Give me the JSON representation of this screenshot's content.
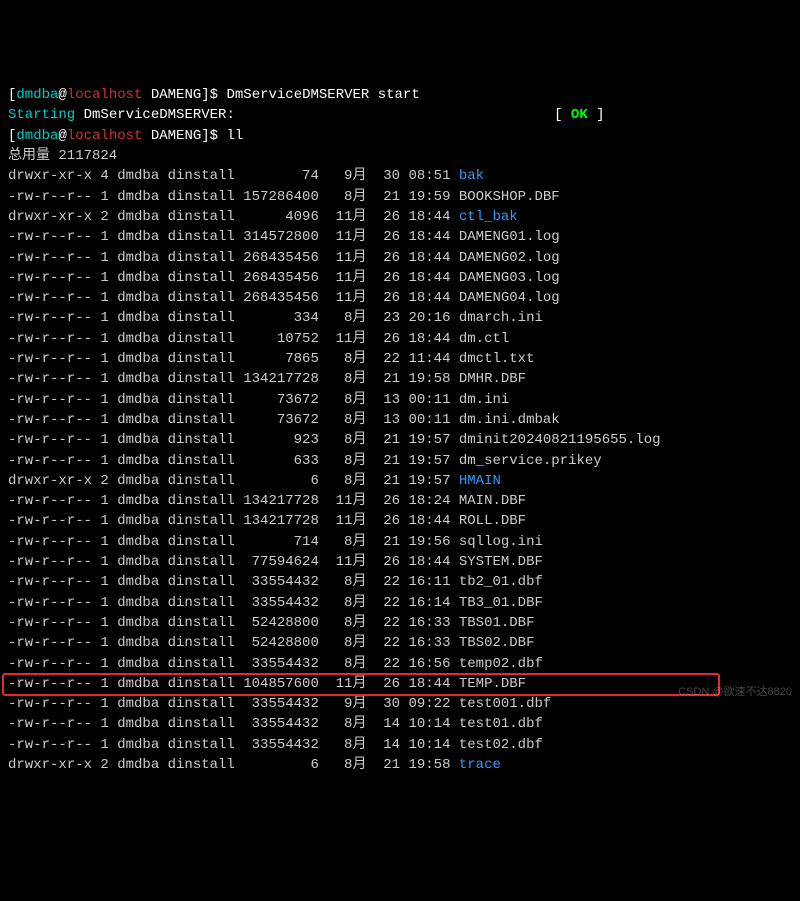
{
  "prompt": {
    "lbracket": "[",
    "user": "dmdba",
    "at": "@",
    "host": "localhost",
    "path": " DAMENG",
    "rbracket": "]$ "
  },
  "cmd1": "DmServiceDMSERVER start",
  "starting_prefix": "Starting ",
  "starting_service": "DmServiceDMSERVER:",
  "starting_pad": "                                      [ ",
  "ok": "OK",
  "starting_end": " ]",
  "cmd2": "ll",
  "total": "总用量 2117824",
  "rows": [
    {
      "perm": "drwxr-xr-x 4",
      "own": "dmdba dinstall",
      "size": "74",
      "mon": "9月",
      "day": "30",
      "time": "08:51",
      "name": "bak",
      "color": "blue"
    },
    {
      "perm": "-rw-r--r-- 1",
      "own": "dmdba dinstall",
      "size": "157286400",
      "mon": "8月",
      "day": "21",
      "time": "19:59",
      "name": "BOOKSHOP.DBF",
      "color": ""
    },
    {
      "perm": "drwxr-xr-x 2",
      "own": "dmdba dinstall",
      "size": "4096",
      "mon": "11月",
      "day": "26",
      "time": "18:44",
      "name": "ctl_bak",
      "color": "blue"
    },
    {
      "perm": "-rw-r--r-- 1",
      "own": "dmdba dinstall",
      "size": "314572800",
      "mon": "11月",
      "day": "26",
      "time": "18:44",
      "name": "DAMENG01.log",
      "color": ""
    },
    {
      "perm": "-rw-r--r-- 1",
      "own": "dmdba dinstall",
      "size": "268435456",
      "mon": "11月",
      "day": "26",
      "time": "18:44",
      "name": "DAMENG02.log",
      "color": ""
    },
    {
      "perm": "-rw-r--r-- 1",
      "own": "dmdba dinstall",
      "size": "268435456",
      "mon": "11月",
      "day": "26",
      "time": "18:44",
      "name": "DAMENG03.log",
      "color": ""
    },
    {
      "perm": "-rw-r--r-- 1",
      "own": "dmdba dinstall",
      "size": "268435456",
      "mon": "11月",
      "day": "26",
      "time": "18:44",
      "name": "DAMENG04.log",
      "color": ""
    },
    {
      "perm": "-rw-r--r-- 1",
      "own": "dmdba dinstall",
      "size": "334",
      "mon": "8月",
      "day": "23",
      "time": "20:16",
      "name": "dmarch.ini",
      "color": ""
    },
    {
      "perm": "-rw-r--r-- 1",
      "own": "dmdba dinstall",
      "size": "10752",
      "mon": "11月",
      "day": "26",
      "time": "18:44",
      "name": "dm.ctl",
      "color": ""
    },
    {
      "perm": "-rw-r--r-- 1",
      "own": "dmdba dinstall",
      "size": "7865",
      "mon": "8月",
      "day": "22",
      "time": "11:44",
      "name": "dmctl.txt",
      "color": ""
    },
    {
      "perm": "-rw-r--r-- 1",
      "own": "dmdba dinstall",
      "size": "134217728",
      "mon": "8月",
      "day": "21",
      "time": "19:58",
      "name": "DMHR.DBF",
      "color": ""
    },
    {
      "perm": "-rw-r--r-- 1",
      "own": "dmdba dinstall",
      "size": "73672",
      "mon": "8月",
      "day": "13",
      "time": "00:11",
      "name": "dm.ini",
      "color": ""
    },
    {
      "perm": "-rw-r--r-- 1",
      "own": "dmdba dinstall",
      "size": "73672",
      "mon": "8月",
      "day": "13",
      "time": "00:11",
      "name": "dm.ini.dmbak",
      "color": ""
    },
    {
      "perm": "-rw-r--r-- 1",
      "own": "dmdba dinstall",
      "size": "923",
      "mon": "8月",
      "day": "21",
      "time": "19:57",
      "name": "dminit20240821195655.log",
      "color": ""
    },
    {
      "perm": "-rw-r--r-- 1",
      "own": "dmdba dinstall",
      "size": "633",
      "mon": "8月",
      "day": "21",
      "time": "19:57",
      "name": "dm_service.prikey",
      "color": ""
    },
    {
      "perm": "drwxr-xr-x 2",
      "own": "dmdba dinstall",
      "size": "6",
      "mon": "8月",
      "day": "21",
      "time": "19:57",
      "name": "HMAIN",
      "color": "blue"
    },
    {
      "perm": "-rw-r--r-- 1",
      "own": "dmdba dinstall",
      "size": "134217728",
      "mon": "11月",
      "day": "26",
      "time": "18:24",
      "name": "MAIN.DBF",
      "color": ""
    },
    {
      "perm": "-rw-r--r-- 1",
      "own": "dmdba dinstall",
      "size": "134217728",
      "mon": "11月",
      "day": "26",
      "time": "18:44",
      "name": "ROLL.DBF",
      "color": ""
    },
    {
      "perm": "-rw-r--r-- 1",
      "own": "dmdba dinstall",
      "size": "714",
      "mon": "8月",
      "day": "21",
      "time": "19:56",
      "name": "sqllog.ini",
      "color": ""
    },
    {
      "perm": "-rw-r--r-- 1",
      "own": "dmdba dinstall",
      "size": "77594624",
      "mon": "11月",
      "day": "26",
      "time": "18:44",
      "name": "SYSTEM.DBF",
      "color": ""
    },
    {
      "perm": "-rw-r--r-- 1",
      "own": "dmdba dinstall",
      "size": "33554432",
      "mon": "8月",
      "day": "22",
      "time": "16:11",
      "name": "tb2_01.dbf",
      "color": ""
    },
    {
      "perm": "-rw-r--r-- 1",
      "own": "dmdba dinstall",
      "size": "33554432",
      "mon": "8月",
      "day": "22",
      "time": "16:14",
      "name": "TB3_01.DBF",
      "color": ""
    },
    {
      "perm": "-rw-r--r-- 1",
      "own": "dmdba dinstall",
      "size": "52428800",
      "mon": "8月",
      "day": "22",
      "time": "16:33",
      "name": "TBS01.DBF",
      "color": ""
    },
    {
      "perm": "-rw-r--r-- 1",
      "own": "dmdba dinstall",
      "size": "52428800",
      "mon": "8月",
      "day": "22",
      "time": "16:33",
      "name": "TBS02.DBF",
      "color": ""
    },
    {
      "perm": "-rw-r--r-- 1",
      "own": "dmdba dinstall",
      "size": "33554432",
      "mon": "8月",
      "day": "22",
      "time": "16:56",
      "name": "temp02.dbf",
      "color": ""
    },
    {
      "perm": "-rw-r--r-- 1",
      "own": "dmdba dinstall",
      "size": "104857600",
      "mon": "11月",
      "day": "26",
      "time": "18:44",
      "name": "TEMP.DBF",
      "color": "",
      "hl": true
    },
    {
      "perm": "-rw-r--r-- 1",
      "own": "dmdba dinstall",
      "size": "33554432",
      "mon": "9月",
      "day": "30",
      "time": "09:22",
      "name": "test001.dbf",
      "color": ""
    },
    {
      "perm": "-rw-r--r-- 1",
      "own": "dmdba dinstall",
      "size": "33554432",
      "mon": "8月",
      "day": "14",
      "time": "10:14",
      "name": "test01.dbf",
      "color": ""
    },
    {
      "perm": "-rw-r--r-- 1",
      "own": "dmdba dinstall",
      "size": "33554432",
      "mon": "8月",
      "day": "14",
      "time": "10:14",
      "name": "test02.dbf",
      "color": ""
    },
    {
      "perm": "drwxr-xr-x 2",
      "own": "dmdba dinstall",
      "size": "6",
      "mon": "8月",
      "day": "21",
      "time": "19:58",
      "name": "trace",
      "color": "blue"
    }
  ],
  "watermark": "CSDN @欲速不达8820"
}
